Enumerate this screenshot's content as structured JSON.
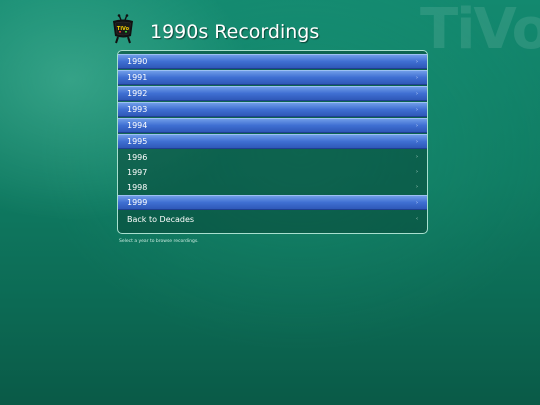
{
  "header": {
    "title": "1990s Recordings",
    "watermark": "TiVo",
    "logo_icon": "tivo-mascot-icon"
  },
  "menu": {
    "items": [
      {
        "label": "1990",
        "highlighted": true,
        "chevron": "›"
      },
      {
        "label": "1991",
        "highlighted": true,
        "chevron": "›"
      },
      {
        "label": "1992",
        "highlighted": true,
        "chevron": "›"
      },
      {
        "label": "1993",
        "highlighted": true,
        "chevron": "›"
      },
      {
        "label": "1994",
        "highlighted": true,
        "chevron": "›"
      },
      {
        "label": "1995",
        "highlighted": true,
        "chevron": "›"
      },
      {
        "label": "1996",
        "highlighted": false,
        "chevron": "›"
      },
      {
        "label": "1997",
        "highlighted": false,
        "chevron": "›"
      },
      {
        "label": "1998",
        "highlighted": false,
        "chevron": "›"
      },
      {
        "label": "1999",
        "highlighted": true,
        "chevron": "›"
      }
    ],
    "back": {
      "label": "Back to Decades",
      "chevron": "‹"
    }
  },
  "footer": {
    "hint": "Select a year to browse recordings."
  },
  "colors": {
    "background": "#0f7b62",
    "highlight": "#3f6fd2",
    "panel_border": "#a8e0cf"
  }
}
